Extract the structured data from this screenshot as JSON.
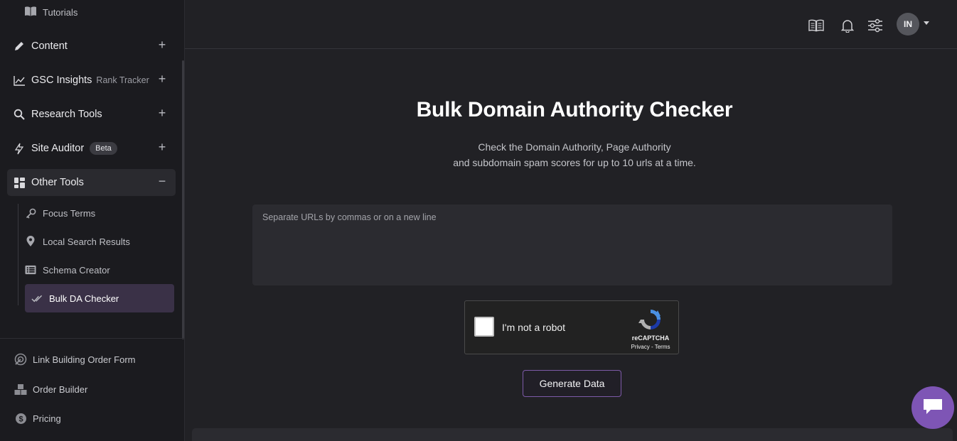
{
  "sidebar": {
    "tutorials_label": "Tutorials",
    "nav": [
      {
        "label": "Content",
        "icon": "pencil-icon"
      },
      {
        "label": "GSC Insights",
        "tag": "Rank Tracker",
        "icon": "chart-line-icon"
      },
      {
        "label": "Research Tools",
        "icon": "magnifier-icon"
      },
      {
        "label": "Site Auditor",
        "badge": "Beta",
        "icon": "lightning-icon"
      },
      {
        "label": "Other Tools",
        "icon": "widgets-icon"
      }
    ],
    "other_tools_items": [
      {
        "label": "Focus Terms",
        "icon": "key-icon"
      },
      {
        "label": "Local Search Results",
        "icon": "map-pin-icon"
      },
      {
        "label": "Schema Creator",
        "icon": "list-box-icon"
      },
      {
        "label": "Bulk DA Checker",
        "icon": "double-check-icon",
        "active": true
      }
    ],
    "bottom": [
      {
        "label": "Link Building Order Form",
        "icon": "link-target-icon"
      },
      {
        "label": "Order Builder",
        "icon": "boxes-icon"
      },
      {
        "label": "Pricing",
        "icon": "dollar-icon"
      }
    ]
  },
  "header": {
    "avatar_initials": "IN"
  },
  "main": {
    "title": "Bulk Domain Authority Checker",
    "desc_line1": "Check the Domain Authority, Page Authority",
    "desc_line2": "and subdomain spam scores for up to 10 urls at a time.",
    "url_placeholder": "Separate URLs by commas or on a new line",
    "captcha_label": "I'm not a robot",
    "captcha_brand": "reCAPTCHA",
    "captcha_links": "Privacy - Terms",
    "generate_label": "Generate Data"
  },
  "colors": {
    "accent": "#7e55b5",
    "background": "#212125",
    "sidebar": "#1b1b1f"
  }
}
